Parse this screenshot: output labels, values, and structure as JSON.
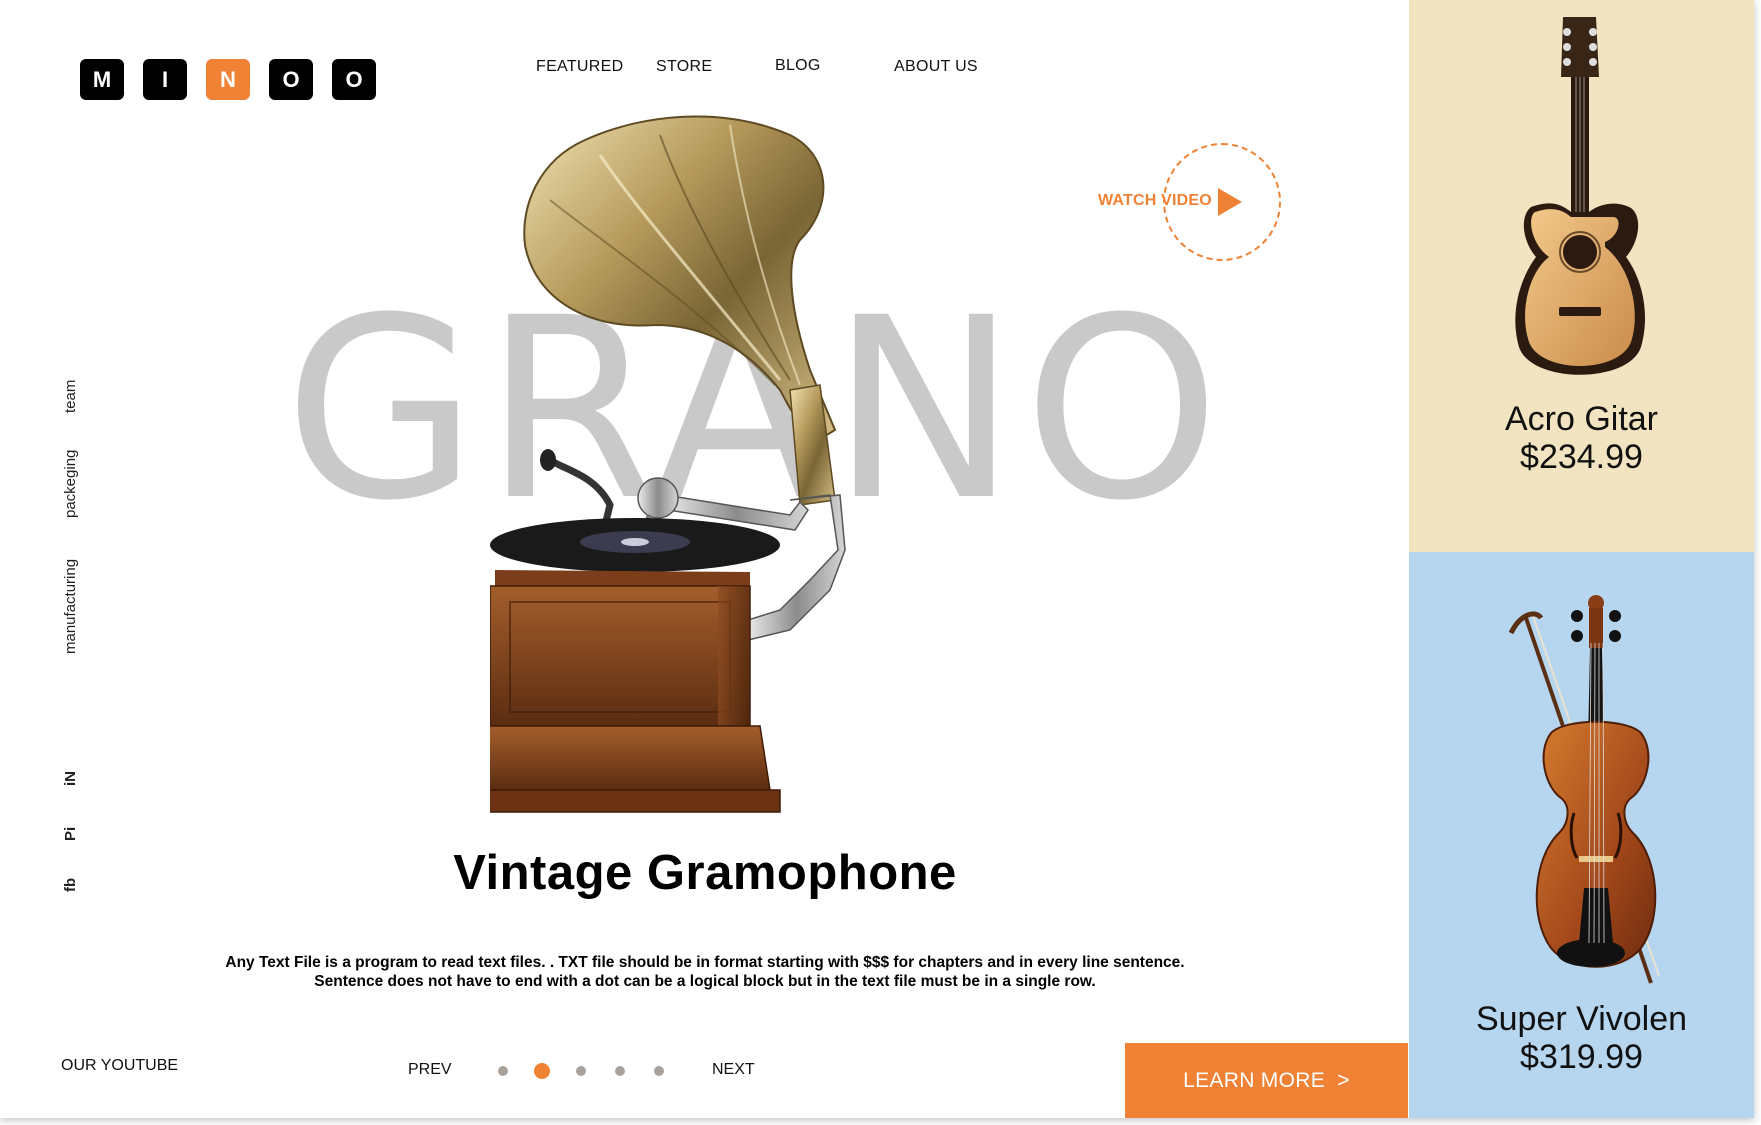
{
  "logo": {
    "letters": [
      "M",
      "I",
      "N",
      "O",
      "O"
    ],
    "accent_index": 2
  },
  "nav": {
    "featured": "FEATURED",
    "store": "STORE",
    "blog": "BLOG",
    "about": "ABOUT US"
  },
  "watch_video": {
    "label": "WATCH VIDEO"
  },
  "hero": {
    "bg_word": "GRANO",
    "title": "Vintage Gramophone",
    "description": "Any Text File is a program to read text files. . TXT file should be in format starting with $$$ for chapters and in every line sentence. Sentence does not have to end with a dot can be a logical block but in the text file must be in a single row."
  },
  "side_nav": {
    "items": [
      "team",
      "packeging",
      "manufacturing"
    ]
  },
  "social": {
    "items": [
      "iN",
      "Pi",
      "fb"
    ]
  },
  "footer": {
    "youtube": "OUR YOUTUBE",
    "prev": "PREV",
    "next": "NEXT",
    "slides": {
      "count": 5,
      "active": 2
    },
    "learn_more": "LEARN MORE  >"
  },
  "products": [
    {
      "name": "Acro Gitar",
      "price": "$234.99"
    },
    {
      "name": "Super Vivolen",
      "price": "$319.99"
    }
  ],
  "colors": {
    "accent": "#f08235",
    "panel_top": "#f2e4c1",
    "panel_bottom": "#b6d6f0",
    "bg_word": "#c9c9c9"
  },
  "icons": [
    "play-icon",
    "chevron-right-icon"
  ]
}
